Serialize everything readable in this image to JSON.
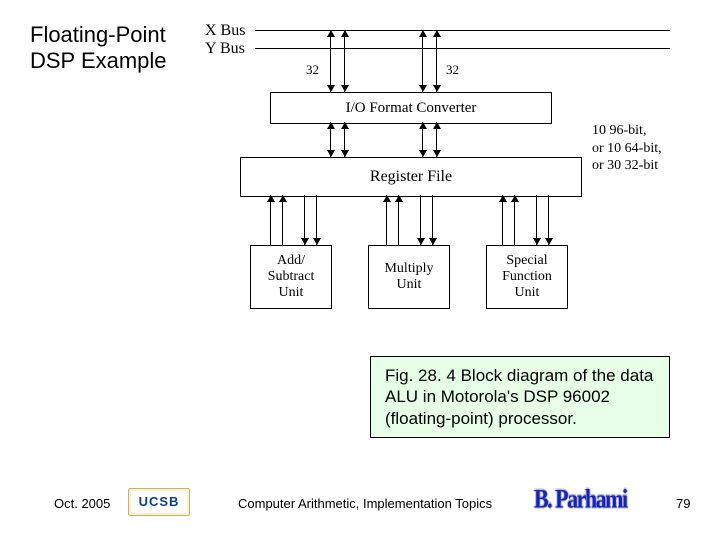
{
  "title_line1": "Floating-Point",
  "title_line2": "DSP Example",
  "diagram": {
    "x_bus": "X Bus",
    "y_bus": "Y Bus",
    "width_a": "32",
    "width_b": "32",
    "io_converter": "I/O Format Converter",
    "register_file": "Register File",
    "reg_note_l1": "10   96-bit,",
    "reg_note_l2": "or 10   64-bit,",
    "reg_note_l3": "or 30   32-bit",
    "unit_addsub_l1": "Add/",
    "unit_addsub_l2": "Subtract",
    "unit_addsub_l3": "Unit",
    "unit_mul_l1": "Multiply",
    "unit_mul_l2": "Unit",
    "unit_sfu_l1": "Special",
    "unit_sfu_l2": "Function",
    "unit_sfu_l3": "Unit"
  },
  "caption": "Fig. 28. 4    Block diagram of the data ALU in Motorola's DSP 96002 (floating-point) processor.",
  "footer": {
    "date": "Oct. 2005",
    "ucsb": "UCSB",
    "topic": "Computer Arithmetic, Implementation Topics",
    "author": "B. Parhami",
    "page": "79"
  }
}
